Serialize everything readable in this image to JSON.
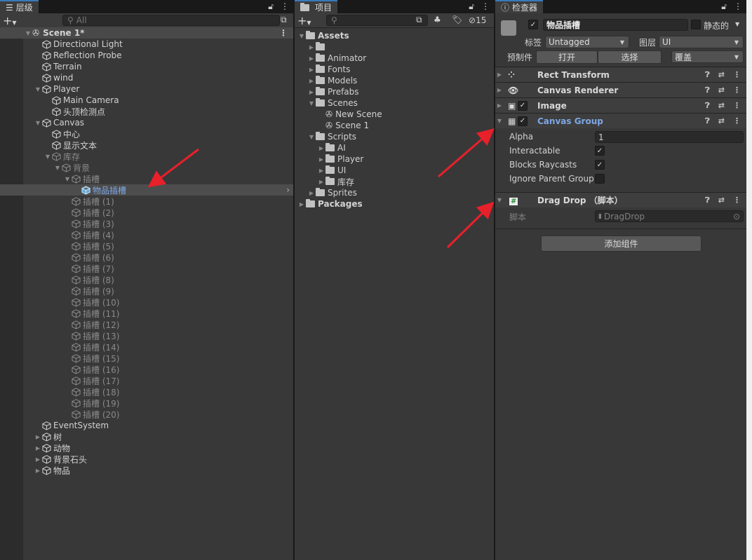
{
  "hierarchy": {
    "tab_label": "层级",
    "search_placeholder": "All",
    "scene": "Scene 1*",
    "items": [
      {
        "label": "Directional Light",
        "depth": 1
      },
      {
        "label": "Reflection Probe",
        "depth": 1
      },
      {
        "label": "Terrain",
        "depth": 1
      },
      {
        "label": "wind",
        "depth": 1
      },
      {
        "label": "Player",
        "depth": 1,
        "arrow": "open"
      },
      {
        "label": "Main Camera",
        "depth": 2
      },
      {
        "label": "头顶检测点",
        "depth": 2
      },
      {
        "label": "Canvas",
        "depth": 1,
        "arrow": "open"
      },
      {
        "label": "中心",
        "depth": 2
      },
      {
        "label": "显示文本",
        "depth": 2
      },
      {
        "label": "库存",
        "depth": 2,
        "arrow": "open",
        "dim": true
      },
      {
        "label": "背景",
        "depth": 3,
        "arrow": "open",
        "dim": true
      },
      {
        "label": "插槽",
        "depth": 4,
        "arrow": "open",
        "dim": true
      },
      {
        "label": "物品插槽",
        "depth": 5,
        "selected": true
      },
      {
        "label": "插槽 (1)",
        "depth": 4,
        "dim": true
      },
      {
        "label": "插槽 (2)",
        "depth": 4,
        "dim": true
      },
      {
        "label": "插槽 (3)",
        "depth": 4,
        "dim": true
      },
      {
        "label": "插槽 (4)",
        "depth": 4,
        "dim": true
      },
      {
        "label": "插槽 (5)",
        "depth": 4,
        "dim": true
      },
      {
        "label": "插槽 (6)",
        "depth": 4,
        "dim": true
      },
      {
        "label": "插槽 (7)",
        "depth": 4,
        "dim": true
      },
      {
        "label": "插槽 (8)",
        "depth": 4,
        "dim": true
      },
      {
        "label": "插槽 (9)",
        "depth": 4,
        "dim": true
      },
      {
        "label": "插槽 (10)",
        "depth": 4,
        "dim": true
      },
      {
        "label": "插槽 (11)",
        "depth": 4,
        "dim": true
      },
      {
        "label": "插槽 (12)",
        "depth": 4,
        "dim": true
      },
      {
        "label": "插槽 (13)",
        "depth": 4,
        "dim": true
      },
      {
        "label": "插槽 (14)",
        "depth": 4,
        "dim": true
      },
      {
        "label": "插槽 (15)",
        "depth": 4,
        "dim": true
      },
      {
        "label": "插槽 (16)",
        "depth": 4,
        "dim": true
      },
      {
        "label": "插槽 (17)",
        "depth": 4,
        "dim": true
      },
      {
        "label": "插槽 (18)",
        "depth": 4,
        "dim": true
      },
      {
        "label": "插槽 (19)",
        "depth": 4,
        "dim": true
      },
      {
        "label": "插槽 (20)",
        "depth": 4,
        "dim": true
      },
      {
        "label": "EventSystem",
        "depth": 1
      },
      {
        "label": "树",
        "depth": 1,
        "arrow": "closed"
      },
      {
        "label": "动物",
        "depth": 1,
        "arrow": "closed"
      },
      {
        "label": "背景石头",
        "depth": 1,
        "arrow": "closed"
      },
      {
        "label": "物品",
        "depth": 1,
        "arrow": "closed"
      }
    ]
  },
  "project": {
    "tab_label": "项目",
    "hidden_count": "15",
    "items": [
      {
        "label": "Assets",
        "depth": 0,
        "arrow": "open",
        "bold": true,
        "icon": "folder-open"
      },
      {
        "label": "",
        "depth": 1,
        "arrow": "closed",
        "icon": "folder"
      },
      {
        "label": "Animator",
        "depth": 1,
        "arrow": "closed",
        "icon": "folder"
      },
      {
        "label": "Fonts",
        "depth": 1,
        "arrow": "closed",
        "icon": "folder"
      },
      {
        "label": "Models",
        "depth": 1,
        "arrow": "closed",
        "icon": "folder"
      },
      {
        "label": "Prefabs",
        "depth": 1,
        "arrow": "closed",
        "icon": "folder"
      },
      {
        "label": "Scenes",
        "depth": 1,
        "arrow": "open",
        "icon": "folder-open"
      },
      {
        "label": "New Scene",
        "depth": 2,
        "icon": "scene"
      },
      {
        "label": "Scene 1",
        "depth": 2,
        "icon": "scene"
      },
      {
        "label": "Scripts",
        "depth": 1,
        "arrow": "open",
        "icon": "folder-open"
      },
      {
        "label": "AI",
        "depth": 2,
        "arrow": "closed",
        "icon": "folder"
      },
      {
        "label": "Player",
        "depth": 2,
        "arrow": "closed",
        "icon": "folder"
      },
      {
        "label": "UI",
        "depth": 2,
        "arrow": "closed",
        "icon": "folder"
      },
      {
        "label": "库存",
        "depth": 2,
        "arrow": "closed",
        "icon": "folder"
      },
      {
        "label": "Sprites",
        "depth": 1,
        "arrow": "closed",
        "icon": "folder"
      },
      {
        "label": "Packages",
        "depth": 0,
        "arrow": "closed",
        "bold": true,
        "icon": "folder"
      }
    ]
  },
  "inspector": {
    "tab_label": "检查器",
    "object_name": "物品插槽",
    "static_label": "静态的",
    "tag_label": "标签",
    "tag_value": "Untagged",
    "layer_label": "图层",
    "layer_value": "UI",
    "prefab_label": "预制件",
    "open_label": "打开",
    "select_label": "选择",
    "overrides_label": "覆盖",
    "components": {
      "rect": "Rect Transform",
      "renderer": "Canvas Renderer",
      "image": "Image",
      "group": "Canvas Group",
      "script": "Drag Drop （脚本）"
    },
    "canvas_group": {
      "alpha_label": "Alpha",
      "alpha_value": "1",
      "interactable_label": "Interactable",
      "interactable": true,
      "blocks_label": "Blocks Raycasts",
      "blocks": true,
      "ignore_label": "Ignore Parent Group",
      "ignore": false
    },
    "script_label": "脚本",
    "script_value": "DragDrop",
    "add_component": "添加组件"
  },
  "colors": {
    "accent": "#7ea7e6",
    "annotation": "#e8202a"
  }
}
